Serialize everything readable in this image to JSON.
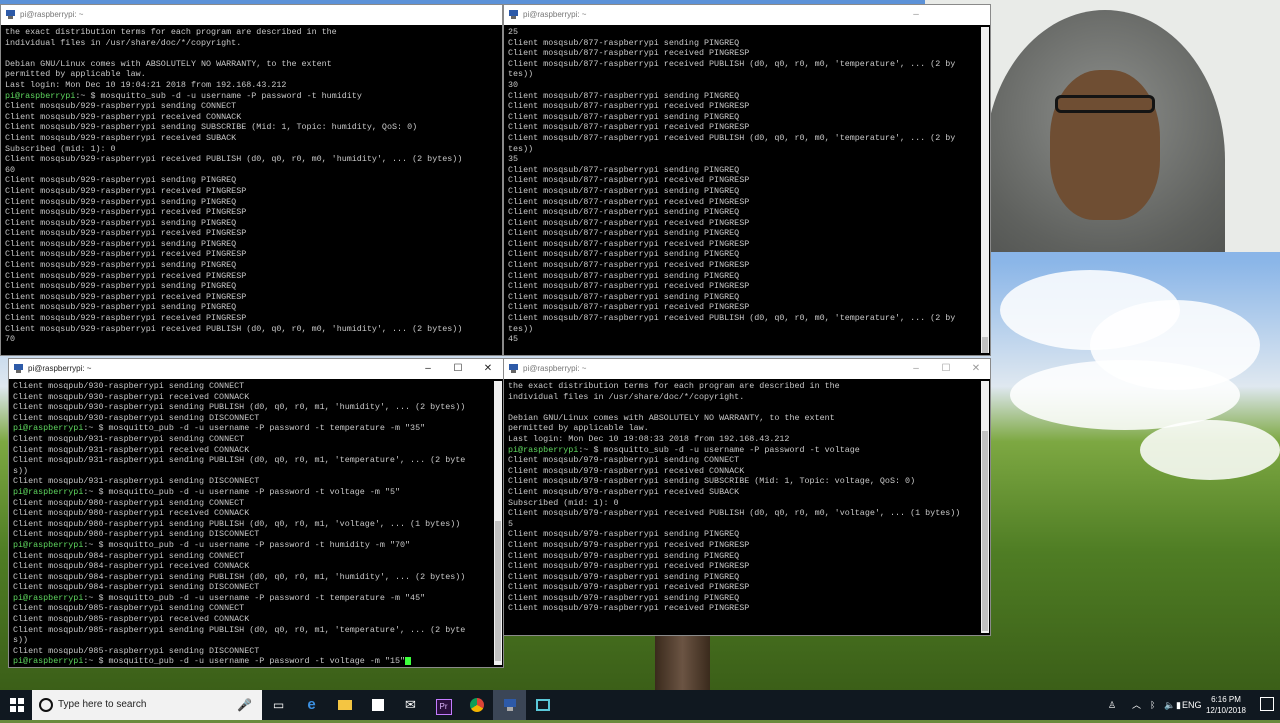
{
  "windows": {
    "top_left": {
      "title": "pi@raspberrypi: ~",
      "lines": [
        {
          "t": "the exact distribution terms for each program are described in the"
        },
        {
          "t": "individual files in /usr/share/doc/*/copyright."
        },
        {
          "t": ""
        },
        {
          "t": "Debian GNU/Linux comes with ABSOLUTELY NO WARRANTY, to the extent"
        },
        {
          "t": "permitted by applicable law."
        },
        {
          "t": "Last login: Mon Dec 10 19:04:21 2018 from 192.168.43.212"
        },
        {
          "p": "pi@raspberrypi",
          "c": ":~ $ mosquitto_sub -d -u username -P password -t humidity"
        },
        {
          "t": "Client mosqsub/929-raspberrypi sending CONNECT"
        },
        {
          "t": "Client mosqsub/929-raspberrypi received CONNACK"
        },
        {
          "t": "Client mosqsub/929-raspberrypi sending SUBSCRIBE (Mid: 1, Topic: humidity, QoS: 0)"
        },
        {
          "t": "Client mosqsub/929-raspberrypi received SUBACK"
        },
        {
          "t": "Subscribed (mid: 1): 0"
        },
        {
          "t": "Client mosqsub/929-raspberrypi received PUBLISH (d0, q0, r0, m0, 'humidity', ... (2 bytes))"
        },
        {
          "t": "60"
        },
        {
          "t": "Client mosqsub/929-raspberrypi sending PINGREQ"
        },
        {
          "t": "Client mosqsub/929-raspberrypi received PINGRESP"
        },
        {
          "t": "Client mosqsub/929-raspberrypi sending PINGREQ"
        },
        {
          "t": "Client mosqsub/929-raspberrypi received PINGRESP"
        },
        {
          "t": "Client mosqsub/929-raspberrypi sending PINGREQ"
        },
        {
          "t": "Client mosqsub/929-raspberrypi received PINGRESP"
        },
        {
          "t": "Client mosqsub/929-raspberrypi sending PINGREQ"
        },
        {
          "t": "Client mosqsub/929-raspberrypi received PINGRESP"
        },
        {
          "t": "Client mosqsub/929-raspberrypi sending PINGREQ"
        },
        {
          "t": "Client mosqsub/929-raspberrypi received PINGRESP"
        },
        {
          "t": "Client mosqsub/929-raspberrypi sending PINGREQ"
        },
        {
          "t": "Client mosqsub/929-raspberrypi received PINGRESP"
        },
        {
          "t": "Client mosqsub/929-raspberrypi sending PINGREQ"
        },
        {
          "t": "Client mosqsub/929-raspberrypi received PINGRESP"
        },
        {
          "t": "Client mosqsub/929-raspberrypi received PUBLISH (d0, q0, r0, m0, 'humidity', ... (2 bytes))"
        },
        {
          "t": "70"
        }
      ]
    },
    "top_right": {
      "title": "pi@raspberrypi: ~",
      "lines": [
        {
          "t": "25"
        },
        {
          "t": "Client mosqsub/877-raspberrypi sending PINGREQ"
        },
        {
          "t": "Client mosqsub/877-raspberrypi received PINGRESP"
        },
        {
          "t": "Client mosqsub/877-raspberrypi received PUBLISH (d0, q0, r0, m0, 'temperature', ... (2 by"
        },
        {
          "t": "tes))"
        },
        {
          "t": "30"
        },
        {
          "t": "Client mosqsub/877-raspberrypi sending PINGREQ"
        },
        {
          "t": "Client mosqsub/877-raspberrypi received PINGRESP"
        },
        {
          "t": "Client mosqsub/877-raspberrypi sending PINGREQ"
        },
        {
          "t": "Client mosqsub/877-raspberrypi received PINGRESP"
        },
        {
          "t": "Client mosqsub/877-raspberrypi received PUBLISH (d0, q0, r0, m0, 'temperature', ... (2 by"
        },
        {
          "t": "tes))"
        },
        {
          "t": "35"
        },
        {
          "t": "Client mosqsub/877-raspberrypi sending PINGREQ"
        },
        {
          "t": "Client mosqsub/877-raspberrypi received PINGRESP"
        },
        {
          "t": "Client mosqsub/877-raspberrypi sending PINGREQ"
        },
        {
          "t": "Client mosqsub/877-raspberrypi received PINGRESP"
        },
        {
          "t": "Client mosqsub/877-raspberrypi sending PINGREQ"
        },
        {
          "t": "Client mosqsub/877-raspberrypi received PINGRESP"
        },
        {
          "t": "Client mosqsub/877-raspberrypi sending PINGREQ"
        },
        {
          "t": "Client mosqsub/877-raspberrypi received PINGRESP"
        },
        {
          "t": "Client mosqsub/877-raspberrypi sending PINGREQ"
        },
        {
          "t": "Client mosqsub/877-raspberrypi received PINGRESP"
        },
        {
          "t": "Client mosqsub/877-raspberrypi sending PINGREQ"
        },
        {
          "t": "Client mosqsub/877-raspberrypi received PINGRESP"
        },
        {
          "t": "Client mosqsub/877-raspberrypi sending PINGREQ"
        },
        {
          "t": "Client mosqsub/877-raspberrypi received PINGRESP"
        },
        {
          "t": "Client mosqsub/877-raspberrypi received PUBLISH (d0, q0, r0, m0, 'temperature', ... (2 by"
        },
        {
          "t": "tes))"
        },
        {
          "t": "45"
        }
      ]
    },
    "bottom_left": {
      "title": "pi@raspberrypi: ~",
      "lines": [
        {
          "t": "Client mosqpub/930-raspberrypi sending CONNECT"
        },
        {
          "t": "Client mosqpub/930-raspberrypi received CONNACK"
        },
        {
          "t": "Client mosqpub/930-raspberrypi sending PUBLISH (d0, q0, r0, m1, 'humidity', ... (2 bytes))"
        },
        {
          "t": "Client mosqpub/930-raspberrypi sending DISCONNECT"
        },
        {
          "p": "pi@raspberrypi",
          "c": ":~ $ mosquitto_pub -d -u username -P password -t temperature -m \"35\""
        },
        {
          "t": "Client mosqpub/931-raspberrypi sending CONNECT"
        },
        {
          "t": "Client mosqpub/931-raspberrypi received CONNACK"
        },
        {
          "t": "Client mosqpub/931-raspberrypi sending PUBLISH (d0, q0, r0, m1, 'temperature', ... (2 byte"
        },
        {
          "t": "s))"
        },
        {
          "t": "Client mosqpub/931-raspberrypi sending DISCONNECT"
        },
        {
          "p": "pi@raspberrypi",
          "c": ":~ $ mosquitto_pub -d -u username -P password -t voltage -m \"5\""
        },
        {
          "t": "Client mosqpub/980-raspberrypi sending CONNECT"
        },
        {
          "t": "Client mosqpub/980-raspberrypi received CONNACK"
        },
        {
          "t": "Client mosqpub/980-raspberrypi sending PUBLISH (d0, q0, r0, m1, 'voltage', ... (1 bytes))"
        },
        {
          "t": "Client mosqpub/980-raspberrypi sending DISCONNECT"
        },
        {
          "p": "pi@raspberrypi",
          "c": ":~ $ mosquitto_pub -d -u username -P password -t humidity -m \"70\""
        },
        {
          "t": "Client mosqpub/984-raspberrypi sending CONNECT"
        },
        {
          "t": "Client mosqpub/984-raspberrypi received CONNACK"
        },
        {
          "t": "Client mosqpub/984-raspberrypi sending PUBLISH (d0, q0, r0, m1, 'humidity', ... (2 bytes))"
        },
        {
          "t": "Client mosqpub/984-raspberrypi sending DISCONNECT"
        },
        {
          "p": "pi@raspberrypi",
          "c": ":~ $ mosquitto_pub -d -u username -P password -t temperature -m \"45\""
        },
        {
          "t": "Client mosqpub/985-raspberrypi sending CONNECT"
        },
        {
          "t": "Client mosqpub/985-raspberrypi received CONNACK"
        },
        {
          "t": "Client mosqpub/985-raspberrypi sending PUBLISH (d0, q0, r0, m1, 'temperature', ... (2 byte"
        },
        {
          "t": "s))"
        },
        {
          "t": "Client mosqpub/985-raspberrypi sending DISCONNECT"
        },
        {
          "p": "pi@raspberrypi",
          "c": ":~ $ mosquitto_pub -d -u username -P password -t voltage -m \"15\"",
          "cursor": true
        }
      ]
    },
    "bottom_right": {
      "title": "pi@raspberrypi: ~",
      "lines": [
        {
          "t": "the exact distribution terms for each program are described in the"
        },
        {
          "t": "individual files in /usr/share/doc/*/copyright."
        },
        {
          "t": ""
        },
        {
          "t": "Debian GNU/Linux comes with ABSOLUTELY NO WARRANTY, to the extent"
        },
        {
          "t": "permitted by applicable law."
        },
        {
          "t": "Last login: Mon Dec 10 19:08:33 2018 from 192.168.43.212"
        },
        {
          "p": "pi@raspberrypi",
          "c": ":~ $ mosquitto_sub -d -u username -P password -t voltage"
        },
        {
          "t": "Client mosqsub/979-raspberrypi sending CONNECT"
        },
        {
          "t": "Client mosqsub/979-raspberrypi received CONNACK"
        },
        {
          "t": "Client mosqsub/979-raspberrypi sending SUBSCRIBE (Mid: 1, Topic: voltage, QoS: 0)"
        },
        {
          "t": "Client mosqsub/979-raspberrypi received SUBACK"
        },
        {
          "t": "Subscribed (mid: 1): 0"
        },
        {
          "t": "Client mosqsub/979-raspberrypi received PUBLISH (d0, q0, r0, m0, 'voltage', ... (1 bytes))"
        },
        {
          "t": "5"
        },
        {
          "t": "Client mosqsub/979-raspberrypi sending PINGREQ"
        },
        {
          "t": "Client mosqsub/979-raspberrypi received PINGRESP"
        },
        {
          "t": "Client mosqsub/979-raspberrypi sending PINGREQ"
        },
        {
          "t": "Client mosqsub/979-raspberrypi received PINGRESP"
        },
        {
          "t": "Client mosqsub/979-raspberrypi sending PINGREQ"
        },
        {
          "t": "Client mosqsub/979-raspberrypi received PINGRESP"
        },
        {
          "t": "Client mosqsub/979-raspberrypi sending PINGREQ"
        },
        {
          "t": "Client mosqsub/979-raspberrypi received PINGRESP"
        }
      ]
    }
  },
  "taskbar": {
    "search_placeholder": "Type here to search",
    "apps": [
      "task-view",
      "edge",
      "file-explorer",
      "store",
      "mail",
      "premiere",
      "chrome",
      "putty",
      "terminal"
    ],
    "language": "ENG",
    "time": "6:16 PM",
    "date": "12/10/2018"
  },
  "colors": {
    "prompt": "#5fd75f",
    "terminal_text": "#c8c8c8",
    "cursor": "#3dff3d",
    "taskbar": "#101820"
  }
}
